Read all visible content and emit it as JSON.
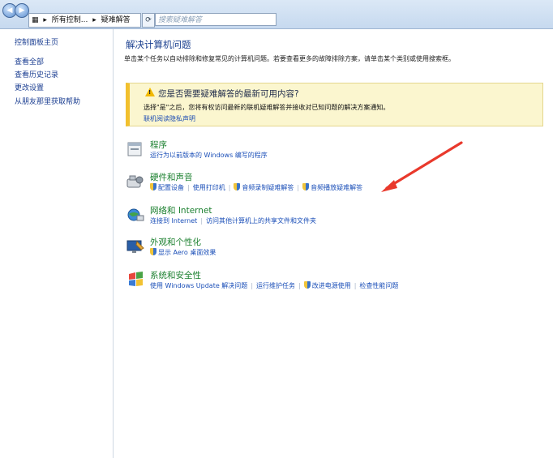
{
  "window": {
    "breadcrumb": [
      "所有控制...",
      "疑难解答"
    ],
    "search_placeholder": "搜索疑难解答"
  },
  "sidebar": {
    "home": "控制面板主页",
    "items": [
      "查看全部",
      "查看历史记录",
      "更改设置",
      "从朋友那里获取帮助"
    ]
  },
  "main": {
    "title": "解决计算机问题",
    "description": "单击某个任务以自动排除和修复常见的计算机问题。若要查看更多的故障排除方案，请单击某个类别或使用搜索框。",
    "notice": {
      "heading": "您是否需要疑难解答的最新可用内容?",
      "body": "选择\"是\"之后，您将有权访问最新的联机疑难解答并接收对已知问题的解决方案通知。",
      "link": "联机阅读隐私声明"
    },
    "categories": [
      {
        "title": "程序",
        "icon": "programs-icon",
        "links": [
          "运行为以前版本的 Windows 编写的程序"
        ]
      },
      {
        "title": "硬件和声音",
        "icon": "hardware-sound-icon",
        "links": [
          "配置设备",
          "使用打印机",
          "音频录制疑难解答",
          "音频播放疑难解答"
        ]
      },
      {
        "title": "网络和 Internet",
        "icon": "network-icon",
        "links": [
          "连接到 Internet",
          "访问其他计算机上的共享文件和文件夹"
        ]
      },
      {
        "title": "外观和个性化",
        "icon": "appearance-icon",
        "links": [
          "显示 Aero 桌面效果"
        ]
      },
      {
        "title": "系统和安全性",
        "icon": "system-security-icon",
        "links": [
          "使用 Windows Update 解决问题",
          "运行维护任务",
          "改进电源使用",
          "检查性能问题"
        ]
      }
    ]
  }
}
